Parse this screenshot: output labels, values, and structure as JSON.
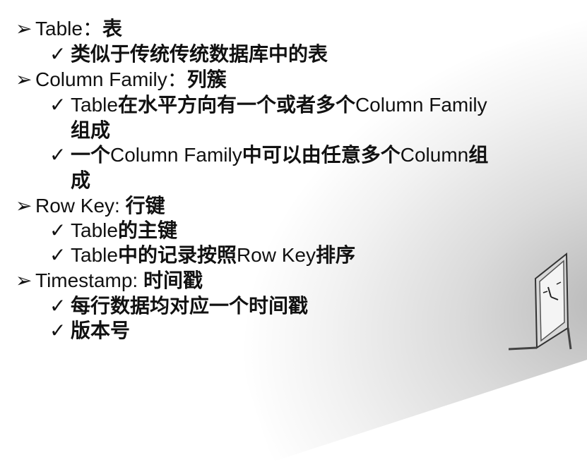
{
  "bullet_marker": "➢",
  "check_marker": "✓",
  "sections": [
    {
      "title_en": "Table：",
      "title_zh": "表",
      "items": [
        {
          "text": "类似于传统传统数据库中的表"
        }
      ]
    },
    {
      "title_en": "Column Family：",
      "title_zh": "列簇",
      "items": [
        {
          "line1_en": "Table",
          "line1_zh": "在水平方向有一个或者多个",
          "line1_en2": "Column Family",
          "line2": "组成"
        },
        {
          "line1_zh": "一个",
          "line1_en": "Column Family",
          "line1_zh2": "中可以由任意多个",
          "line1_en2": "Column",
          "line1_zh3": "组",
          "line2": "成"
        }
      ]
    },
    {
      "title_en": "Row Key: ",
      "title_zh": "行键",
      "items": [
        {
          "en": "Table",
          "zh": "的主键"
        },
        {
          "en": "Table",
          "zh": "中的记录按照",
          "en2": "Row Key",
          "zh2": "排序"
        }
      ]
    },
    {
      "title_en": "Timestamp: ",
      "title_zh": "时间戳",
      "items": [
        {
          "text": "每行数据均对应一个时间戳"
        },
        {
          "text": "版本号"
        }
      ]
    }
  ]
}
